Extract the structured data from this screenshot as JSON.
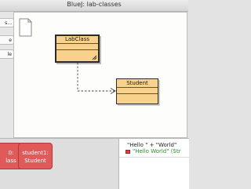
{
  "window": {
    "title": "BlueJ: lab-classes"
  },
  "toolbar": {
    "buttons": [
      "s...",
      "e",
      "le"
    ]
  },
  "diagram": {
    "classes": [
      {
        "name": "LabClass",
        "selected": true
      },
      {
        "name": "Student",
        "selected": false
      }
    ],
    "relation": "uses (dashed arrow)"
  },
  "object_bench": {
    "objects": [
      {
        "line1": "0:",
        "line2": "lass"
      },
      {
        "line1": "student1:",
        "line2": "Student"
      }
    ]
  },
  "codepad": {
    "expression": "\"Hello \" + \"World\"",
    "result": "\"Hello World\"  (Str"
  },
  "colors": {
    "class_fill": "#f8d28d",
    "object_fill": "#e05a5a",
    "result_text": "#2e8b2e"
  }
}
